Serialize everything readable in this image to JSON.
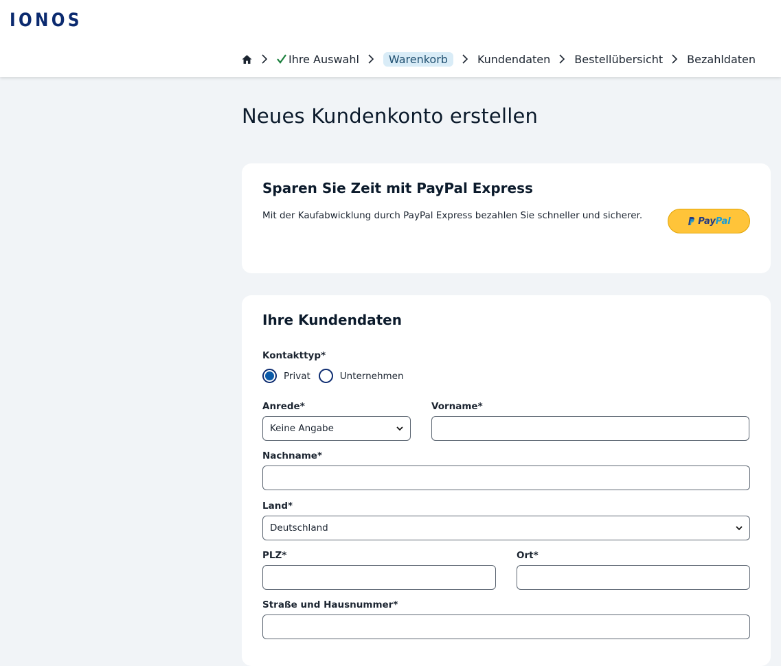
{
  "brand": {
    "logo_text": "IONOS",
    "color": "#0b2a6f"
  },
  "breadcrumb": {
    "home_icon": "home-icon",
    "items": [
      {
        "label": "Ihre Auswahl",
        "completed": true
      },
      {
        "label": "Warenkorb",
        "active": true
      },
      {
        "label": "Kundendaten"
      },
      {
        "label": "Bestellübersicht"
      },
      {
        "label": "Bezahldaten"
      }
    ]
  },
  "page": {
    "title": "Neues Kundenkonto erstellen"
  },
  "paypal_card": {
    "title": "Sparen Sie Zeit mit PayPal Express",
    "description": "Mit der Kaufabwicklung durch PayPal Express bezahlen Sie schneller und sicherer.",
    "button_label_a": "Pay",
    "button_label_b": "Pal",
    "button_color": "#ffc439"
  },
  "customer_card": {
    "title": "Ihre Kundendaten",
    "contact_type": {
      "label": "Kontakttyp*",
      "options": [
        "Privat",
        "Unternehmen"
      ],
      "selected": "Privat"
    },
    "salutation": {
      "label": "Anrede*",
      "value": "Keine Angabe"
    },
    "first_name": {
      "label": "Vorname*",
      "value": ""
    },
    "last_name": {
      "label": "Nachname*",
      "value": ""
    },
    "country": {
      "label": "Land*",
      "value": "Deutschland"
    },
    "zip": {
      "label": "PLZ*",
      "value": ""
    },
    "city": {
      "label": "Ort*",
      "value": ""
    },
    "street": {
      "label": "Straße und Hausnummer*",
      "value": ""
    }
  }
}
